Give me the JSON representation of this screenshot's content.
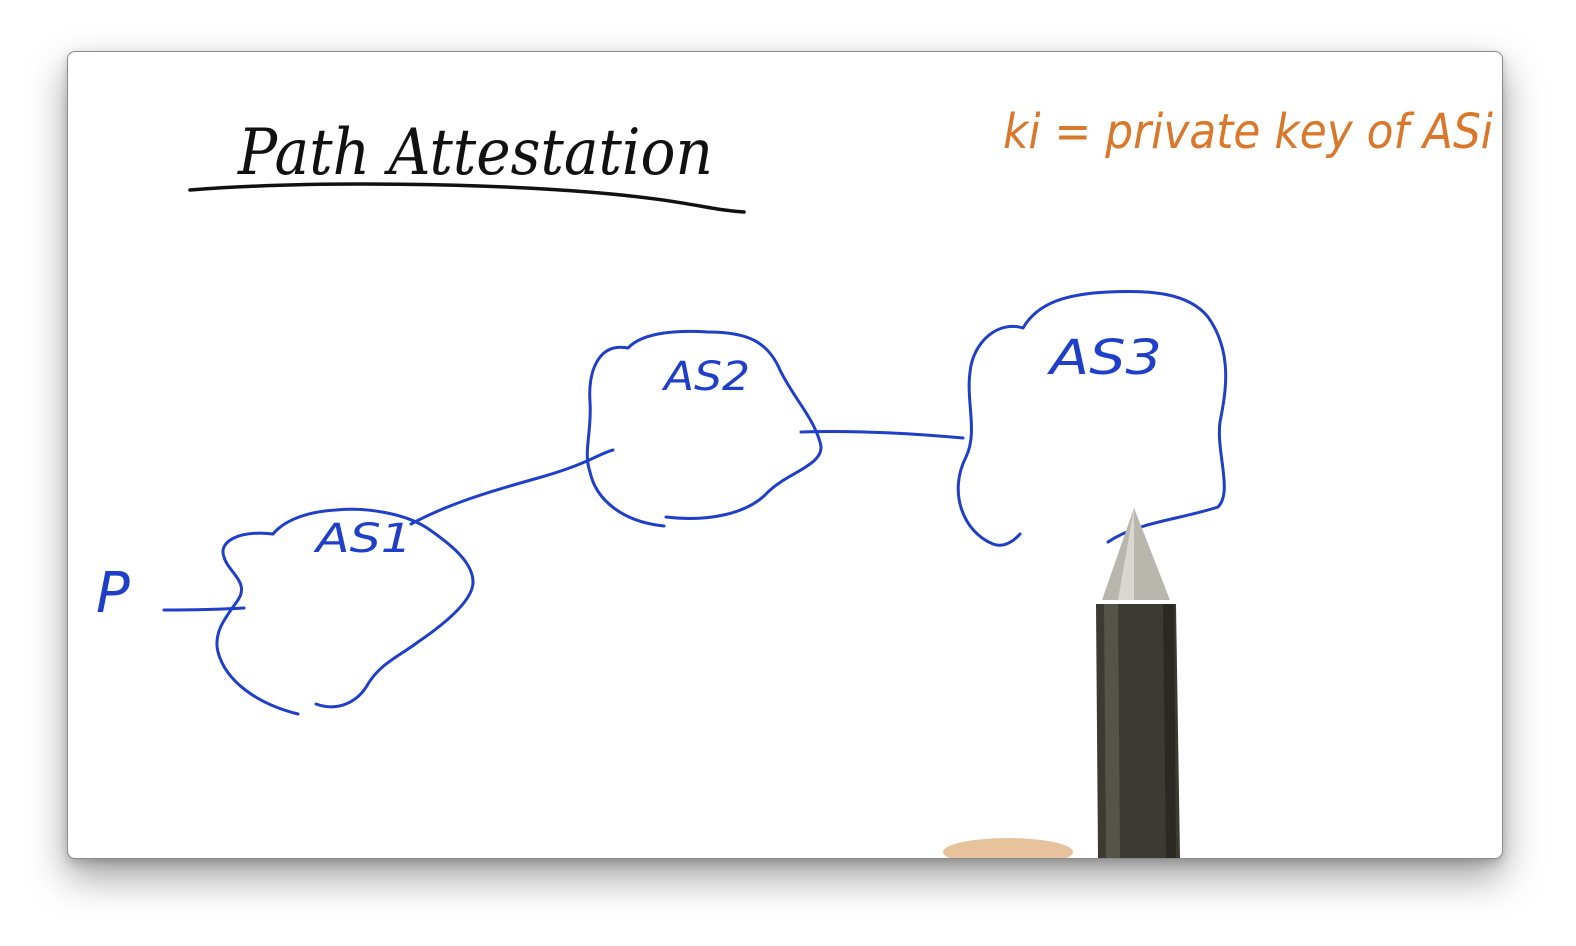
{
  "title": "Path Attestation",
  "note": "ki = private key of ASi",
  "prefix_label": "P",
  "nodes": [
    {
      "id": "as1",
      "label": "AS1"
    },
    {
      "id": "as2",
      "label": "AS2"
    },
    {
      "id": "as3",
      "label": "AS3"
    }
  ],
  "colors": {
    "ink_black": "#111111",
    "ink_blue": "#1f3fc8",
    "ink_orange": "#d9782a",
    "pen_body": "#3b3a33"
  },
  "icons": {
    "pen": "pen-icon"
  }
}
